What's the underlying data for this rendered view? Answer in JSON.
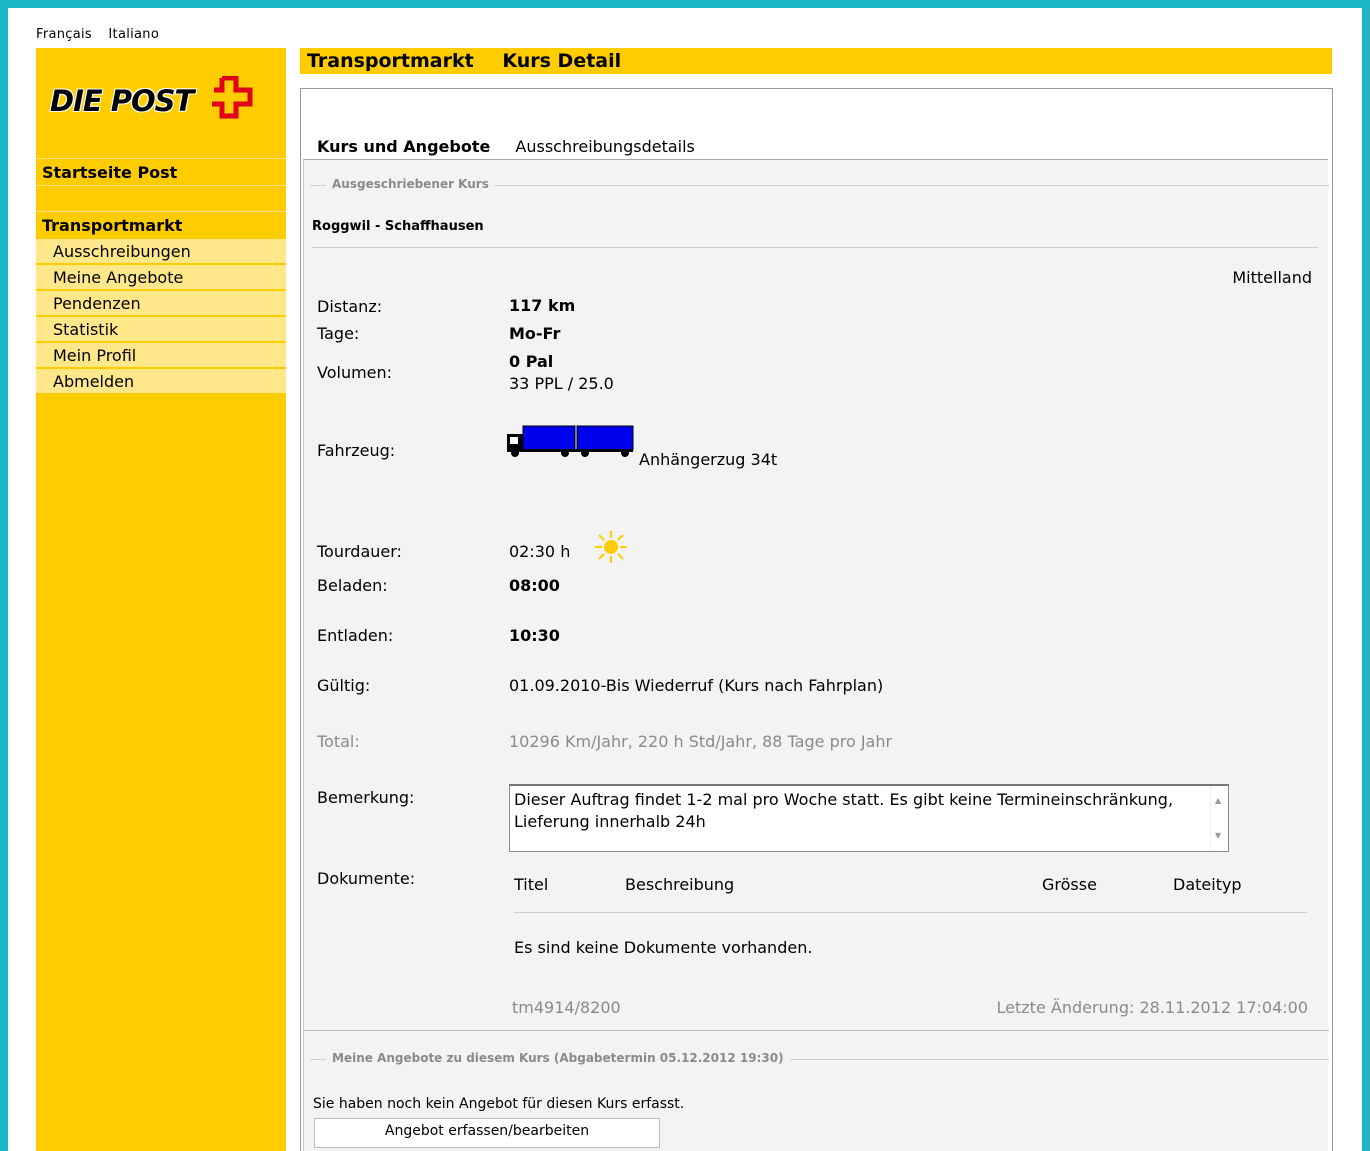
{
  "languages": [
    "Français",
    "Italiano"
  ],
  "logo": {
    "text": "DIE POST"
  },
  "sidebar": {
    "home": "Startseite Post",
    "section": "Transportmarkt",
    "items": [
      "Ausschreibungen",
      "Meine Angebote",
      "Pendenzen",
      "Statistik",
      "Mein Profil",
      "Abmelden"
    ]
  },
  "header": {
    "title_left": "Transportmarkt",
    "title_right": "Kurs Detail"
  },
  "tabs": [
    {
      "label": "Kurs und Angebote",
      "active": true
    },
    {
      "label": "Ausschreibungsdetails",
      "active": false
    }
  ],
  "kurs": {
    "legend": "Ausgeschriebener Kurs",
    "route": "Roggwil - Schaffhausen",
    "region": "Mittelland",
    "distanz_label": "Distanz:",
    "distanz": "117 km",
    "tage_label": "Tage:",
    "tage": "Mo-Fr",
    "volumen_label": "Volumen:",
    "volumen": "0 Pal",
    "volumen_sub": "33 PPL / 25.0",
    "fahrzeug_label": "Fahrzeug:",
    "fahrzeug": "Anhängerzug 34t",
    "tourdauer_label": "Tourdauer:",
    "tourdauer": "02:30 h",
    "beladen_label": "Beladen:",
    "beladen": "08:00",
    "entladen_label": "Entladen:",
    "entladen": "10:30",
    "gueltig_label": "Gültig:",
    "gueltig": "01.09.2010-Bis Wiederruf (Kurs nach Fahrplan)",
    "total_label": "Total:",
    "total": "10296 Km/Jahr, 220 h Std/Jahr, 88 Tage pro Jahr",
    "bemerkung_label": "Bemerkung:",
    "bemerkung": "Dieser Auftrag findet 1-2 mal pro Woche statt. Es gibt keine Termineinschränkung, Lieferung innerhalb 24h",
    "dokumente_label": "Dokumente:",
    "doc_columns": [
      "Titel",
      "Beschreibung",
      "Grösse",
      "Dateityp"
    ],
    "doc_empty": "Es sind keine Dokumente vorhanden.",
    "ref": "tm4914/8200",
    "last_change": "Letzte Änderung: 28.11.2012 17:04:00"
  },
  "angebote": {
    "legend": "Meine Angebote zu diesem Kurs (Abgabetermin 05.12.2012 19:30)",
    "none_text": "Sie haben noch kein Angebot für diesen Kurs erfasst.",
    "button": "Angebot erfassen/bearbeiten"
  },
  "colors": {
    "brand_yellow": "#ffcc00",
    "truck_blue": "#0000ee",
    "sun": "#ffcc00"
  }
}
